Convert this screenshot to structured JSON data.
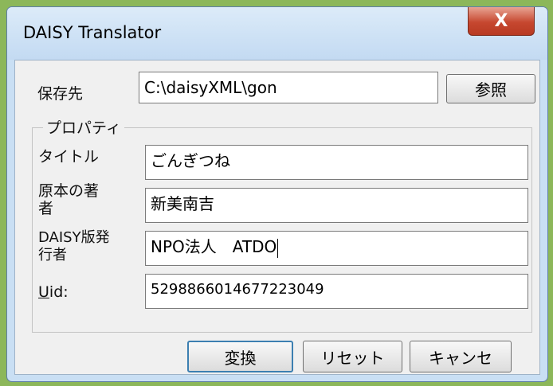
{
  "window": {
    "title": "DAISY Translator",
    "close_label": "X"
  },
  "save": {
    "label": "保存先",
    "value": "C:\\daisyXML\\gon",
    "browse_label": "参照"
  },
  "properties": {
    "group_title": "プロパティ",
    "title_label": "タイトル",
    "title_value": "ごんぎつね",
    "author_label_line1": "原本の著",
    "author_label_line2": "者",
    "author_value": "新美南吉",
    "publisher_label_line1": "DAISY版発",
    "publisher_label_line2": "行者",
    "publisher_value": "NPO法人　ATDO",
    "uid_label_mnemonic": "U",
    "uid_label_rest": "id:",
    "uid_value": "5298866014677223049"
  },
  "buttons": {
    "convert": "変換",
    "reset": "リセット",
    "cancel": "キャンセ"
  }
}
